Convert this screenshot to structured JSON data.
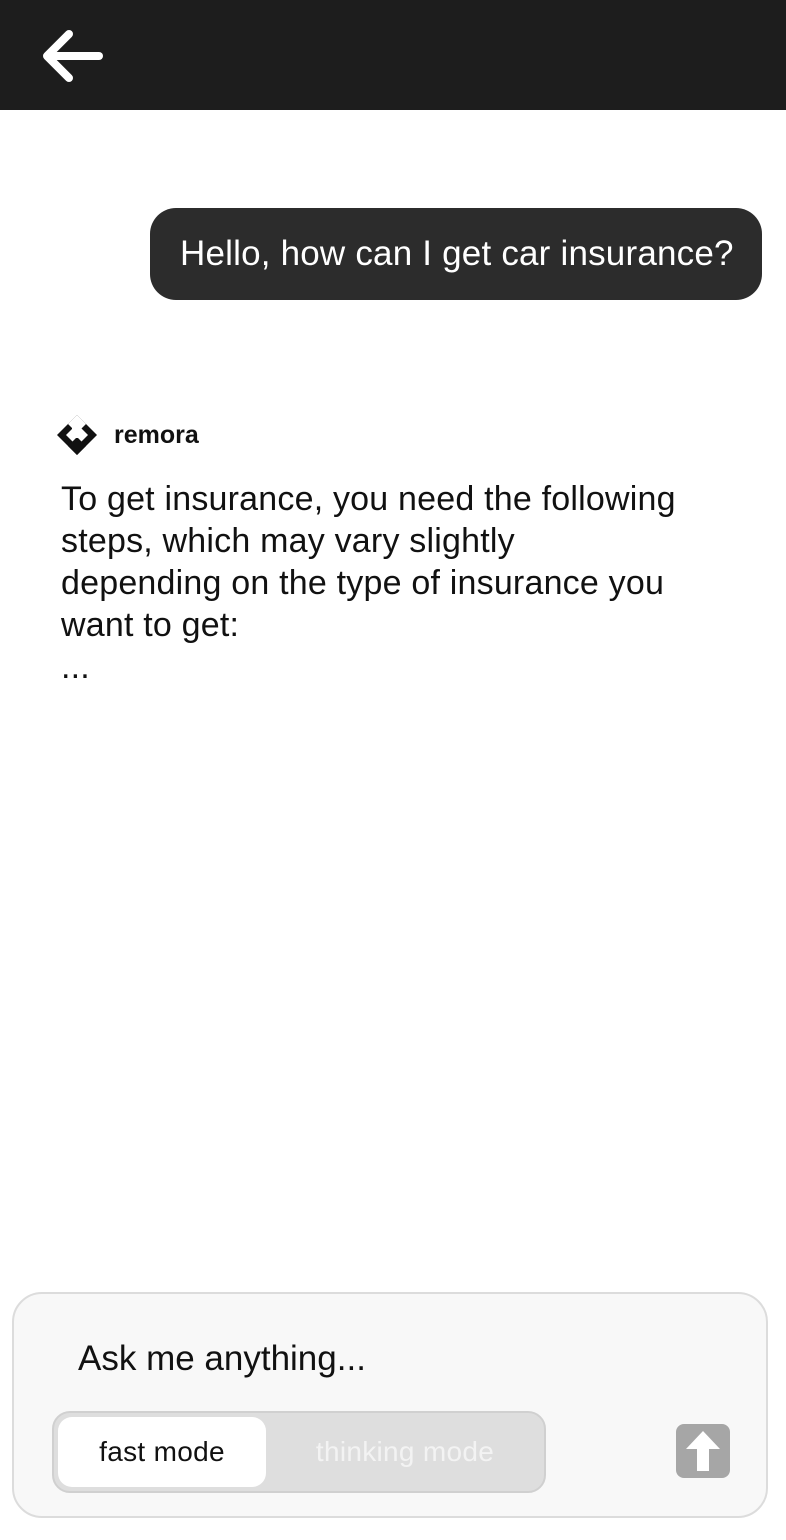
{
  "header": {
    "back_icon": "arrow-left-icon"
  },
  "conversation": {
    "user_message": "Hello, how can I get car insurance?",
    "assistant": {
      "logo_icon": "remora-logo-icon",
      "name": "remora",
      "lines": [
        "To get insurance, you need the following",
        "steps, which may vary slightly",
        "depending on the type of insurance you",
        "want to get:",
        "..."
      ]
    }
  },
  "composer": {
    "placeholder": "Ask me anything...",
    "modes": {
      "fast": "fast mode",
      "thinking": "thinking mode",
      "selected": "fast mode"
    },
    "send_icon": "arrow-up-icon"
  },
  "colors": {
    "top_bar": "#1d1d1d",
    "user_bubble": "#2c2c2c",
    "send_button": "#a6a6a6"
  }
}
